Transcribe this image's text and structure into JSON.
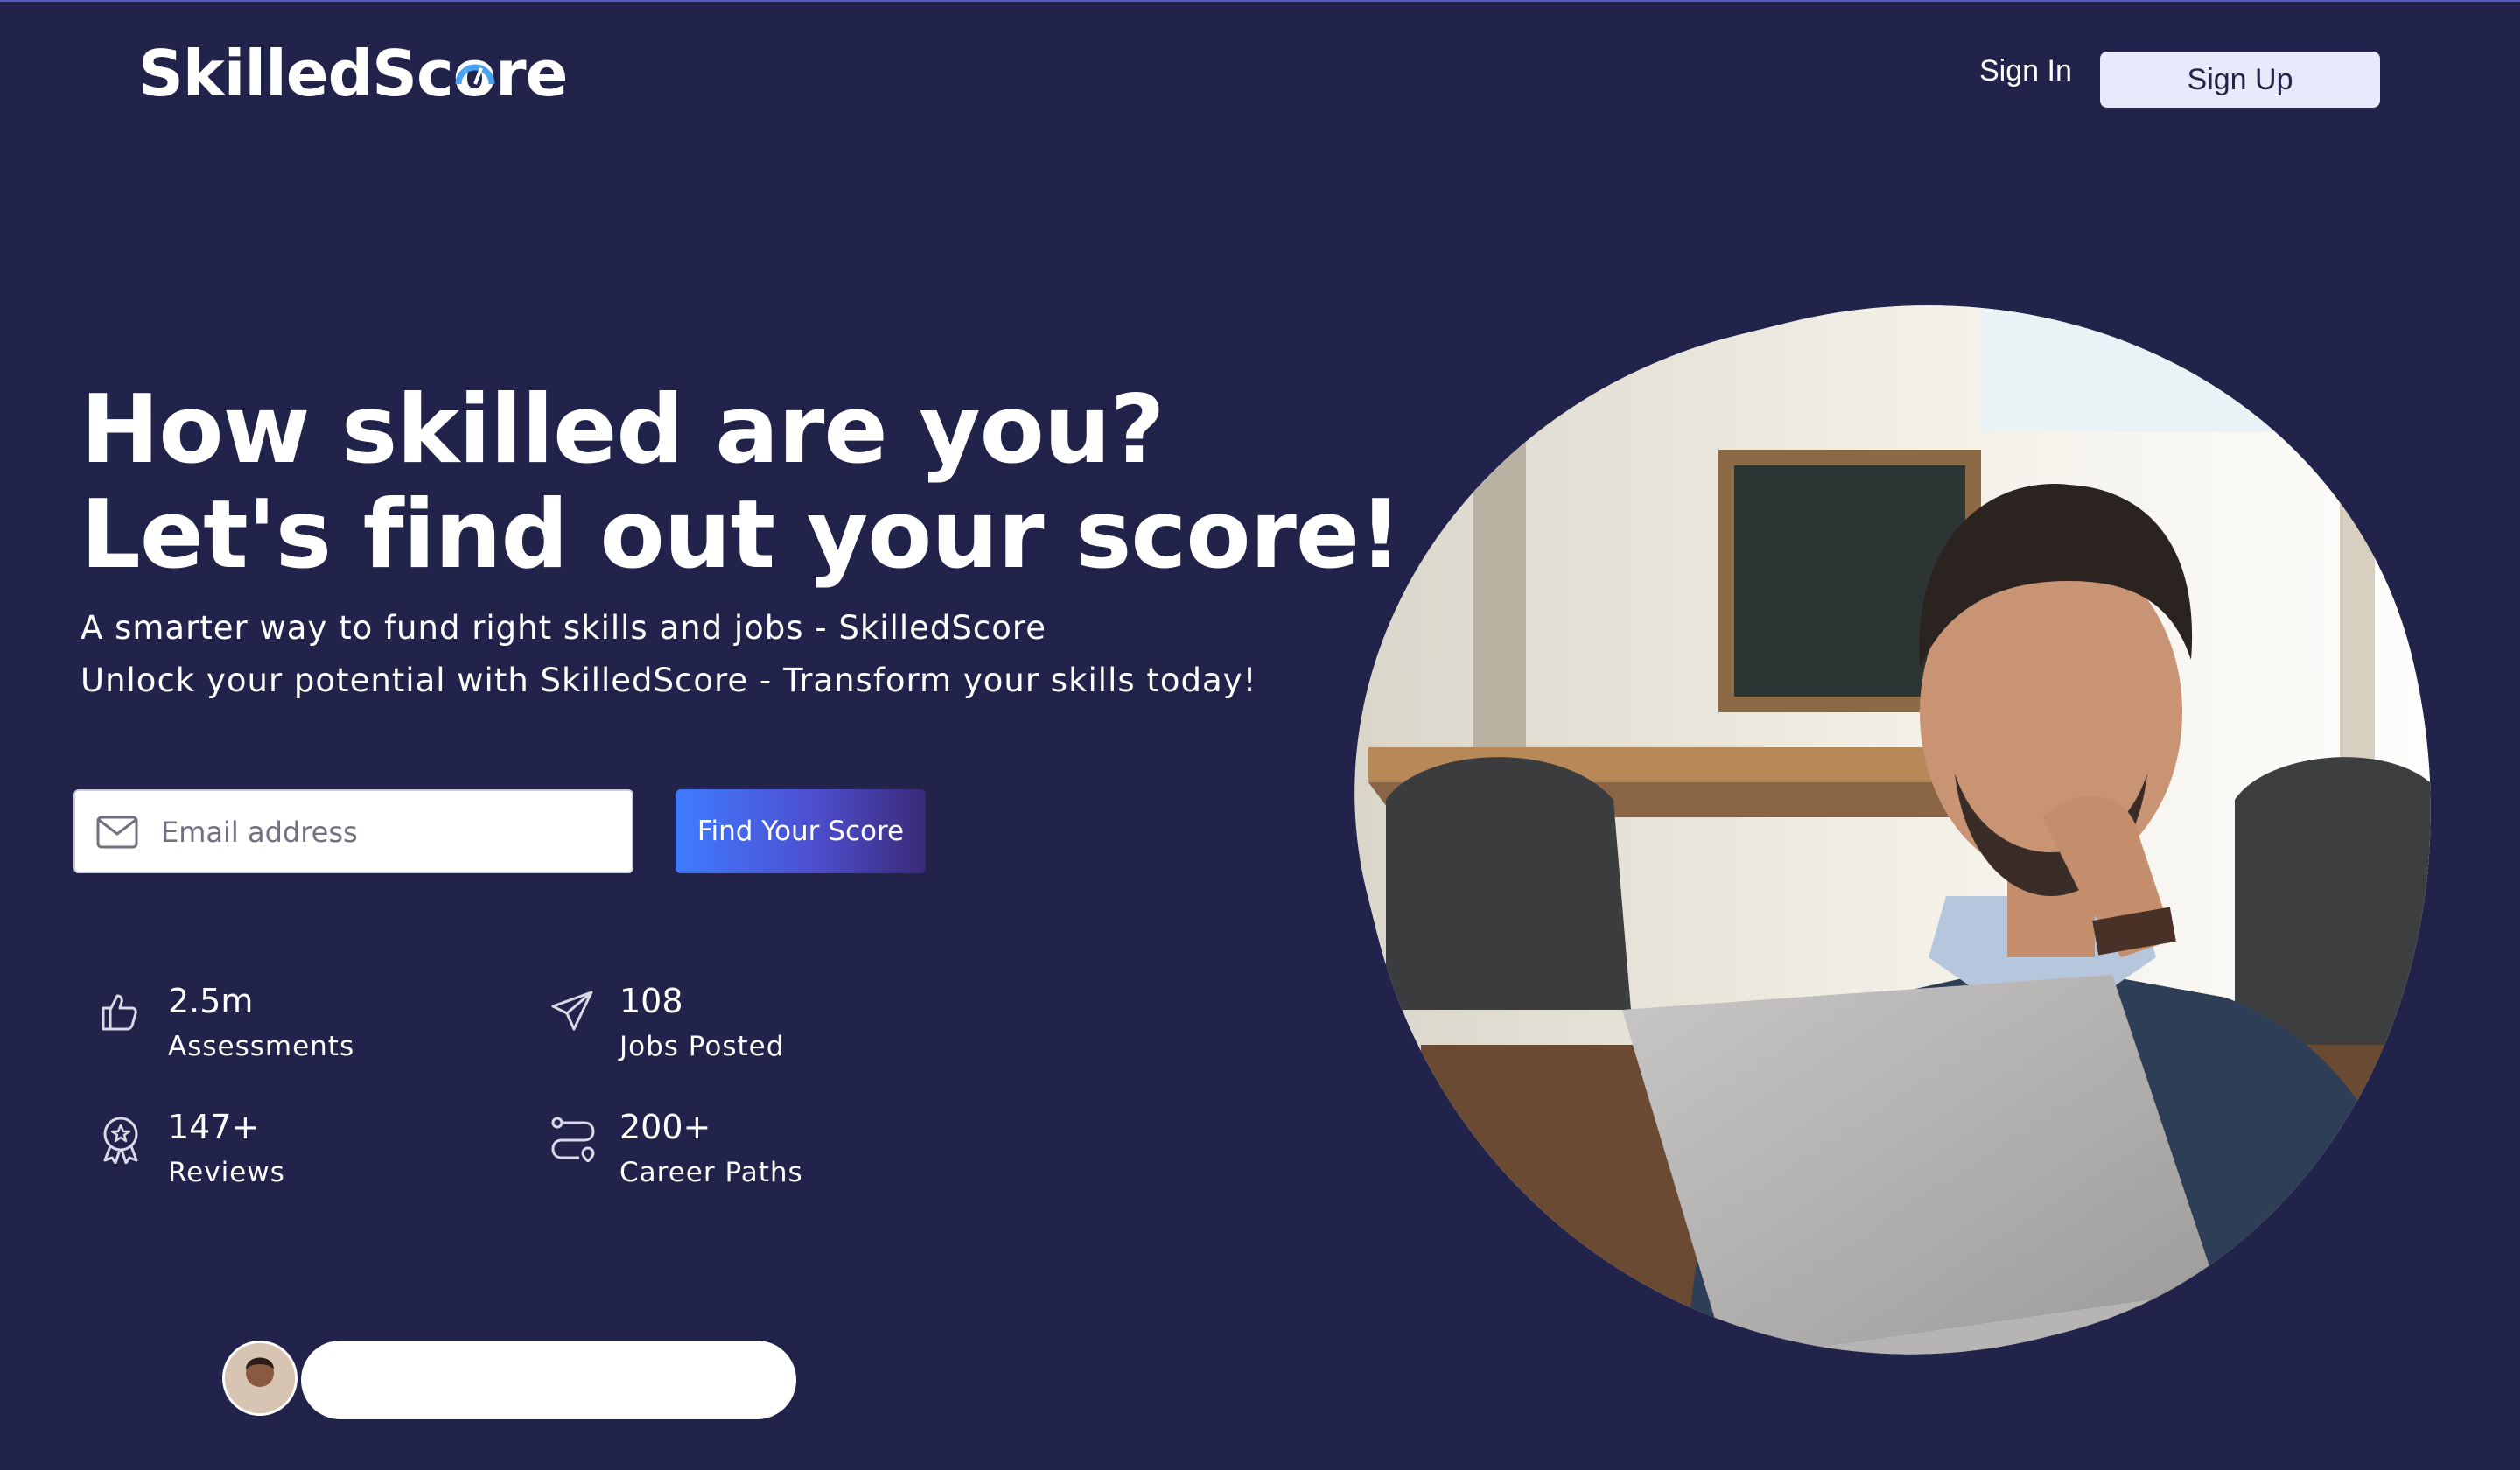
{
  "brand": {
    "logo_text_a": "SkilledSc",
    "logo_text_b": "re"
  },
  "nav": {
    "sign_in": "Sign In",
    "sign_up": "Sign Up"
  },
  "hero": {
    "headline_line1": "How skilled are you?",
    "headline_line2": "Let's find out your score!",
    "sub_line1": "A smarter way to fund right skills and jobs - SkilledScore",
    "sub_line2": "Unlock your potential with SkilledScore - Transform your skills today!"
  },
  "signup_form": {
    "email_placeholder": "Email address",
    "email_value": "",
    "submit_label": "Find Your Score"
  },
  "stats": [
    {
      "value": "2.5m",
      "label": "Assessments",
      "icon": "thumbs-up-icon"
    },
    {
      "value": "108",
      "label": "Jobs Posted",
      "icon": "paper-plane-icon"
    },
    {
      "value": "147+",
      "label": "Reviews",
      "icon": "award-badge-icon"
    },
    {
      "value": "200+",
      "label": "Career Paths",
      "icon": "route-icon"
    }
  ],
  "colors": {
    "background": "#21234a",
    "button_gradient_start": "#3f7bff",
    "button_gradient_end": "#3b2a78",
    "sign_up_bg": "#e8e9fa",
    "logo_gauge": "#4aa3f0"
  }
}
